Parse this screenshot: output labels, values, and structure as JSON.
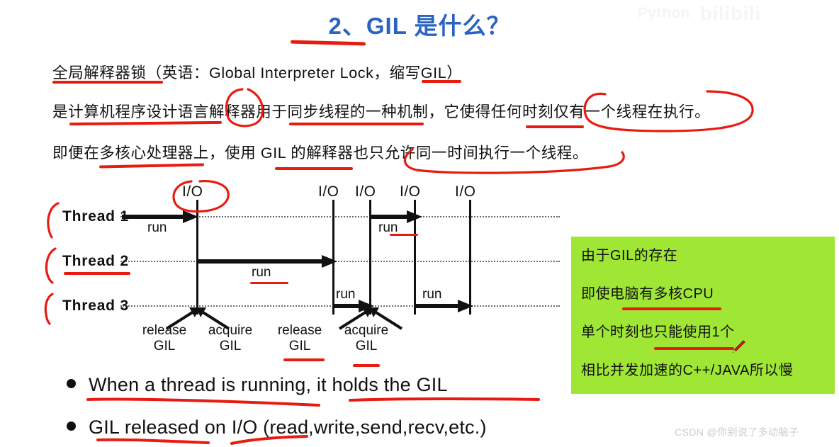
{
  "watermarks": {
    "top_python": "Python",
    "top_bilibili": "bilibili",
    "bottom": "CSDN @你别说了多动脑子"
  },
  "title": {
    "text": "2、GIL 是什么？",
    "color": "#2a63c4"
  },
  "paragraphs": [
    "全局解释器锁（英语：Global Interpreter Lock，缩写GIL）",
    "是计算机程序设计语言解释器用于同步线程的一种机制，它使得任何时刻仅有一个线程在执行。",
    "即便在多核心处理器上，使用 GIL 的解释器也只允许同一时间执行一个线程。"
  ],
  "diagram": {
    "threads": [
      {
        "label": "Thread 1"
      },
      {
        "label": "Thread 2"
      },
      {
        "label": "Thread 3"
      }
    ],
    "io_markers": [
      {
        "label": "I/O"
      },
      {
        "label": "I/O"
      },
      {
        "label": "I/O"
      },
      {
        "label": "I/O"
      },
      {
        "label": "I/O"
      }
    ],
    "run_labels": [
      {
        "label": "run",
        "thread": 1
      },
      {
        "label": "run",
        "thread": 2
      },
      {
        "label": "run",
        "thread": 1
      },
      {
        "label": "run",
        "thread": 3
      },
      {
        "label": "run",
        "thread": 3
      }
    ],
    "gil_events": [
      {
        "action": "release",
        "resource": "GIL"
      },
      {
        "action": "acquire",
        "resource": "GIL"
      },
      {
        "action": "release",
        "resource": "GIL"
      },
      {
        "action": "acquire",
        "resource": "GIL"
      }
    ]
  },
  "green_box": {
    "background": "#9fe635",
    "lines": [
      "由于GIL的存在",
      "即使电脑有多核CPU",
      "单个时刻也只能使用1个",
      "相比并发加速的C++/JAVA所以慢"
    ]
  },
  "bullets": [
    "When a thread is running, it holds the GIL",
    "GIL released on I/O (read,write,send,recv,etc.)"
  ],
  "annotation_color": "#e81b10"
}
